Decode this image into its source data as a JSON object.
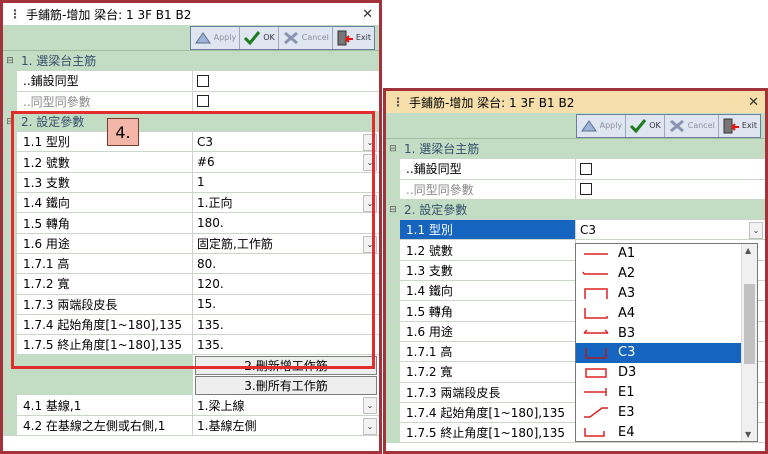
{
  "left": {
    "title": "手鋪筋-增加 梁台: 1 3F B1 B2",
    "toolbar": {
      "apply": "Apply",
      "ok": "OK",
      "cancel": "Cancel",
      "exit": "Exit"
    },
    "cat1": "1. 選梁台主筋",
    "rows_a": [
      {
        "label": "..鋪設同型",
        "value": ""
      },
      {
        "label": "..同型同參數",
        "value": ""
      }
    ],
    "cat2": "2. 設定參數",
    "rows_b": [
      {
        "label": "1.1 型別",
        "value": "C3"
      },
      {
        "label": "1.2 號數",
        "value": "#6"
      },
      {
        "label": "1.3 支數",
        "value": "1"
      },
      {
        "label": "1.4 鐵向",
        "value": "1.正向"
      },
      {
        "label": "1.5 轉角",
        "value": "180."
      },
      {
        "label": "1.6 用途",
        "value": "固定筋,工作筋"
      },
      {
        "label": "1.7.1 高",
        "value": "80."
      },
      {
        "label": "1.7.2 寬",
        "value": "120."
      },
      {
        "label": "1.7.3 兩端段皮長",
        "value": "15."
      },
      {
        "label": "1.7.4 起始角度[1~180],135",
        "value": "135."
      },
      {
        "label": "1.7.5 終止角度[1~180],135",
        "value": "135."
      }
    ],
    "btn1": "2.刪新增工作筋",
    "btn2": "3.刪所有工作筋",
    "rows_c": [
      {
        "label": "4.1 基線,1",
        "value": "1.梁上線"
      },
      {
        "label": "4.2 在基線之左側或右側,1",
        "value": "1.基線左側"
      }
    ],
    "callout": "4."
  },
  "right": {
    "title": "手鋪筋-增加 梁台: 1 3F B1 B2",
    "toolbar": {
      "apply": "Apply",
      "ok": "OK",
      "cancel": "Cancel",
      "exit": "Exit"
    },
    "cat1": "1. 選梁台主筋",
    "rows_a": [
      {
        "label": "..鋪設同型"
      },
      {
        "label": "..同型同參數"
      }
    ],
    "cat2": "2. 設定參數",
    "rows_b": [
      {
        "label": "1.1 型別",
        "value": "C3"
      },
      {
        "label": "1.2 號數"
      },
      {
        "label": "1.3 支數"
      },
      {
        "label": "1.4 鐵向"
      },
      {
        "label": "1.5 轉角"
      },
      {
        "label": "1.6 用途"
      },
      {
        "label": "1.7.1 高"
      },
      {
        "label": "1.7.2 寬"
      },
      {
        "label": "1.7.3 兩端段皮長"
      },
      {
        "label": "1.7.4 起始角度[1~180],135"
      },
      {
        "label": "1.7.5 終止角度[1~180],135"
      }
    ],
    "dropdown_options": [
      "A1",
      "A2",
      "A3",
      "A4",
      "B3",
      "C3",
      "D3",
      "E1",
      "E3",
      "E4"
    ],
    "selected_option": "C3"
  },
  "colors": {
    "highlight": "#1565c0",
    "category": "#c3dcc4",
    "window_border": "#a2333a",
    "callout_box": "#e12d2d"
  }
}
